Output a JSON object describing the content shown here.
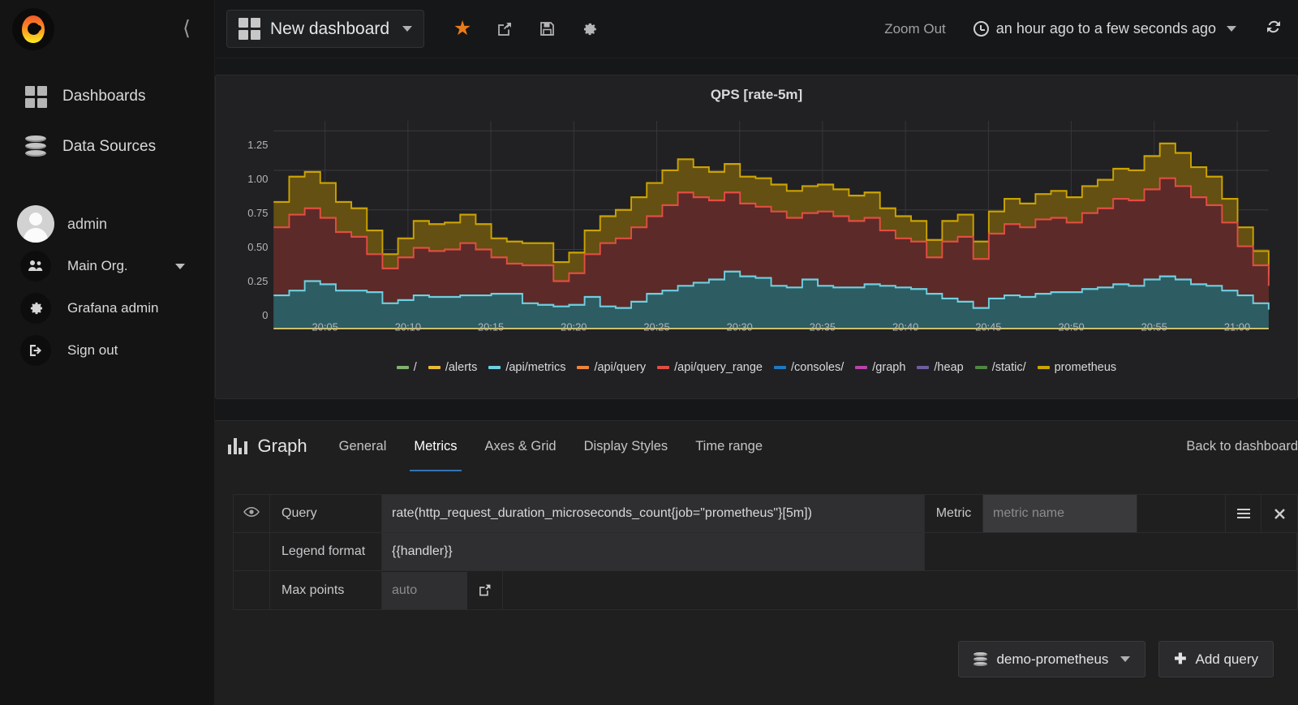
{
  "sidebar": {
    "logo_icon": "grafana-logo-icon",
    "collapse_icon": "chevron-left-icon",
    "nav": [
      {
        "label": "Dashboards",
        "icon": "grid-icon"
      },
      {
        "label": "Data Sources",
        "icon": "database-icon"
      }
    ],
    "user": {
      "name": "admin",
      "avatar_icon": "avatar-icon"
    },
    "account": [
      {
        "label": "Main Org.",
        "icon": "users-icon",
        "has_caret": true
      },
      {
        "label": "Grafana admin",
        "icon": "gear-icon",
        "has_caret": false
      },
      {
        "label": "Sign out",
        "icon": "sign-out-icon",
        "has_caret": false
      }
    ]
  },
  "topbar": {
    "dashboard_title": "New dashboard",
    "dashboard_icon": "grid-icon",
    "icons": [
      {
        "name": "star-icon",
        "glyph": "★"
      },
      {
        "name": "share-icon",
        "glyph": "↪"
      },
      {
        "name": "save-icon",
        "glyph": "ὋE"
      },
      {
        "name": "gear-icon",
        "glyph": "⚙"
      }
    ],
    "zoom_out_label": "Zoom Out",
    "time_range_label": "an hour ago to a few seconds ago",
    "time_range_icon": "clock-icon",
    "refresh_icon": "refresh-icon"
  },
  "panel": {
    "title": "QPS [rate-5m]"
  },
  "chart_data": {
    "type": "area",
    "title": "QPS [rate-5m]",
    "xlabel": "",
    "ylabel": "",
    "ylim": [
      0,
      1.3125
    ],
    "ytick_labels": [
      "0",
      "0.25",
      "0.50",
      "0.75",
      "1.00",
      "1.25"
    ],
    "ytick_values": [
      0,
      0.25,
      0.5,
      0.75,
      1.0,
      1.25
    ],
    "xtick_labels": [
      "20:05",
      "20:10",
      "20:15",
      "20:20",
      "20:25",
      "20:30",
      "20:35",
      "20:40",
      "20:45",
      "20:50",
      "20:55",
      "21:00"
    ],
    "grid": true,
    "legend_position": "bottom",
    "stacked": true,
    "legend": [
      {
        "name": "/",
        "color": "#7eb26d"
      },
      {
        "name": "/alerts",
        "color": "#eab839"
      },
      {
        "name": "/api/metrics",
        "color": "#6ed0e0"
      },
      {
        "name": "/api/query",
        "color": "#ef843c"
      },
      {
        "name": "/api/query_range",
        "color": "#e24d42"
      },
      {
        "name": "/consoles/",
        "color": "#1f78c1"
      },
      {
        "name": "/graph",
        "color": "#ba43a9"
      },
      {
        "name": "/heap",
        "color": "#705da0"
      },
      {
        "name": "/static/",
        "color": "#508642"
      },
      {
        "name": "prometheus",
        "color": "#cca300"
      }
    ],
    "series": [
      {
        "name": "/api/metrics",
        "color": "#6ed0e0",
        "fill": "#2d5c63",
        "values": [
          0.21,
          0.24,
          0.3,
          0.28,
          0.24,
          0.24,
          0.23,
          0.16,
          0.18,
          0.21,
          0.2,
          0.2,
          0.21,
          0.21,
          0.22,
          0.22,
          0.16,
          0.15,
          0.14,
          0.15,
          0.2,
          0.14,
          0.13,
          0.17,
          0.22,
          0.24,
          0.27,
          0.29,
          0.31,
          0.36,
          0.33,
          0.32,
          0.27,
          0.26,
          0.31,
          0.27,
          0.26,
          0.26,
          0.28,
          0.27,
          0.26,
          0.25,
          0.22,
          0.19,
          0.17,
          0.13,
          0.19,
          0.21,
          0.2,
          0.22,
          0.23,
          0.23,
          0.25,
          0.26,
          0.28,
          0.27,
          0.31,
          0.33,
          0.31,
          0.28,
          0.27,
          0.24,
          0.21,
          0.16,
          0.12
        ]
      },
      {
        "name": "/api/query_range",
        "color": "#e24d42",
        "fill": "#5c2a29",
        "values": [
          0.64,
          0.72,
          0.76,
          0.7,
          0.61,
          0.58,
          0.47,
          0.38,
          0.45,
          0.51,
          0.49,
          0.5,
          0.54,
          0.5,
          0.45,
          0.41,
          0.4,
          0.4,
          0.3,
          0.35,
          0.47,
          0.54,
          0.57,
          0.64,
          0.71,
          0.78,
          0.86,
          0.83,
          0.81,
          0.86,
          0.79,
          0.77,
          0.74,
          0.7,
          0.73,
          0.74,
          0.71,
          0.68,
          0.7,
          0.62,
          0.57,
          0.55,
          0.45,
          0.55,
          0.58,
          0.44,
          0.6,
          0.66,
          0.64,
          0.69,
          0.7,
          0.67,
          0.73,
          0.76,
          0.82,
          0.81,
          0.88,
          0.95,
          0.9,
          0.83,
          0.78,
          0.67,
          0.52,
          0.4,
          0.27
        ]
      },
      {
        "name": "prometheus",
        "color": "#cca300",
        "fill": "#635012",
        "values": [
          0.8,
          0.96,
          0.99,
          0.92,
          0.8,
          0.76,
          0.62,
          0.47,
          0.57,
          0.68,
          0.66,
          0.67,
          0.72,
          0.66,
          0.57,
          0.55,
          0.54,
          0.54,
          0.42,
          0.48,
          0.62,
          0.71,
          0.75,
          0.83,
          0.92,
          1.0,
          1.07,
          1.02,
          0.99,
          1.04,
          0.96,
          0.95,
          0.91,
          0.87,
          0.9,
          0.91,
          0.88,
          0.84,
          0.86,
          0.76,
          0.71,
          0.68,
          0.56,
          0.68,
          0.72,
          0.55,
          0.74,
          0.82,
          0.79,
          0.85,
          0.87,
          0.83,
          0.9,
          0.94,
          1.01,
          1.0,
          1.09,
          1.17,
          1.11,
          1.02,
          0.96,
          0.82,
          0.64,
          0.49,
          0.33
        ]
      }
    ]
  },
  "editor": {
    "panel_type": "Graph",
    "panel_type_icon": "bar-chart-icon",
    "tabs": [
      {
        "label": "General",
        "active": false
      },
      {
        "label": "Metrics",
        "active": true
      },
      {
        "label": "Axes & Grid",
        "active": false
      },
      {
        "label": "Display Styles",
        "active": false
      },
      {
        "label": "Time range",
        "active": false
      }
    ],
    "back_label": "Back to dashboard",
    "rows": {
      "eye_icon": "eye-icon",
      "query_label": "Query",
      "query_value": "rate(http_request_duration_microseconds_count{job=\"prometheus\"}[5m])",
      "metric_label": "Metric",
      "metric_placeholder": "metric name",
      "metric_value": "",
      "menu_icon": "hamburger-icon",
      "close_icon": "close-icon",
      "legend_label": "Legend format",
      "legend_value": "{{handler}}",
      "maxpoints_label": "Max points",
      "maxpoints_placeholder": "auto",
      "maxpoints_value": "",
      "maxpoints_share_icon": "external-link-icon"
    },
    "datasource_button": {
      "label": "demo-prometheus",
      "icon": "database-icon",
      "caret": true
    },
    "add_query_button": {
      "label": "Add query",
      "icon": "plus-icon"
    }
  }
}
